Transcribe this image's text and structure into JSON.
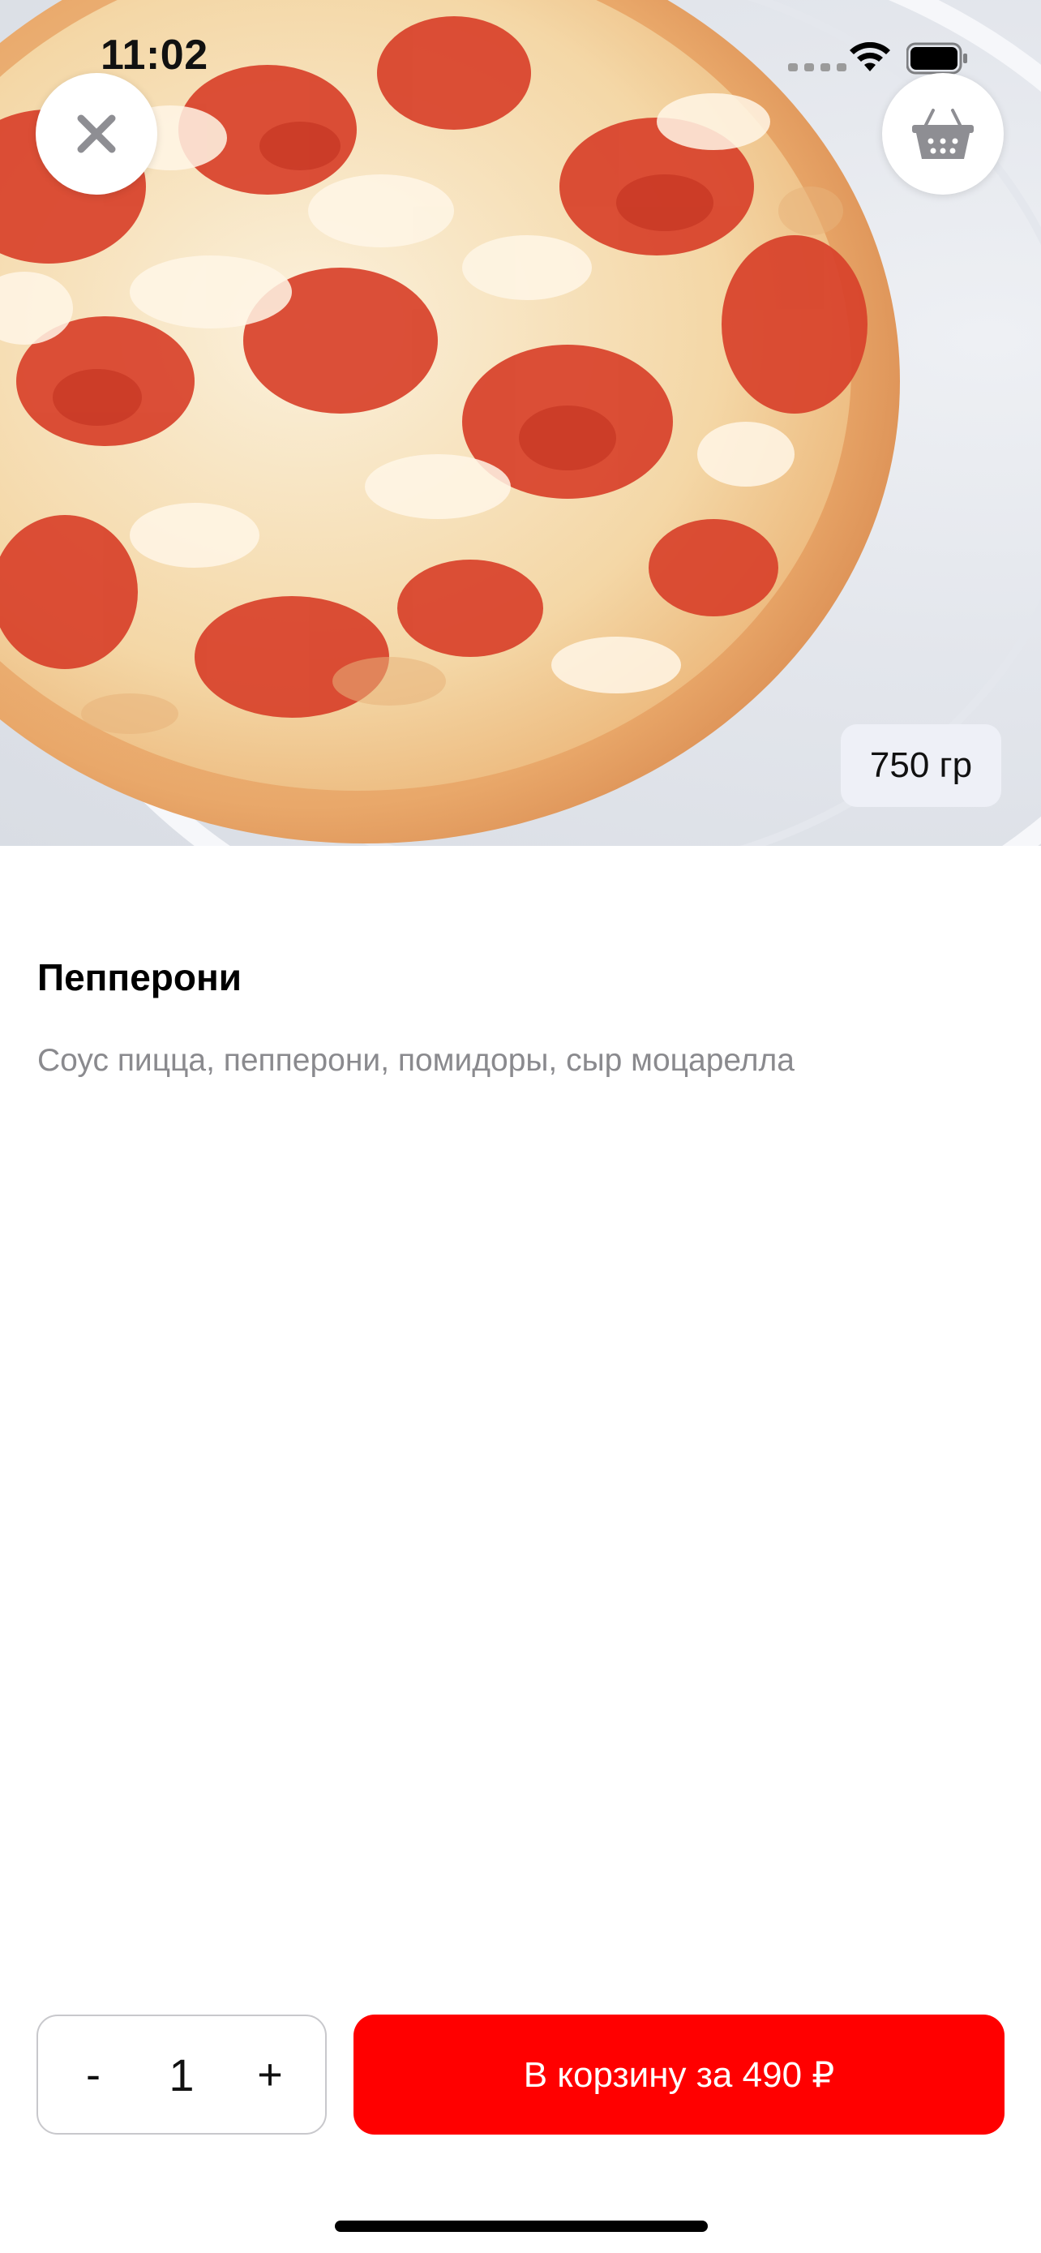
{
  "status_bar": {
    "time": "11:02"
  },
  "hero": {
    "image": "pepperoni-pizza-photo",
    "weight": "750 гр"
  },
  "header": {
    "close_icon": "close-icon",
    "cart_icon": "basket-icon"
  },
  "product": {
    "name": "Пепперони",
    "description": "Соус пицца, пепперони, помидоры, сыр моцарелла"
  },
  "footer": {
    "minus_label": "-",
    "quantity": "1",
    "plus_label": "+",
    "add_to_cart_label": "В корзину за 490 ₽"
  },
  "colors": {
    "accent": "#ff0000",
    "badge_bg": "#eef0f7",
    "muted_text": "#8a8a8e"
  }
}
